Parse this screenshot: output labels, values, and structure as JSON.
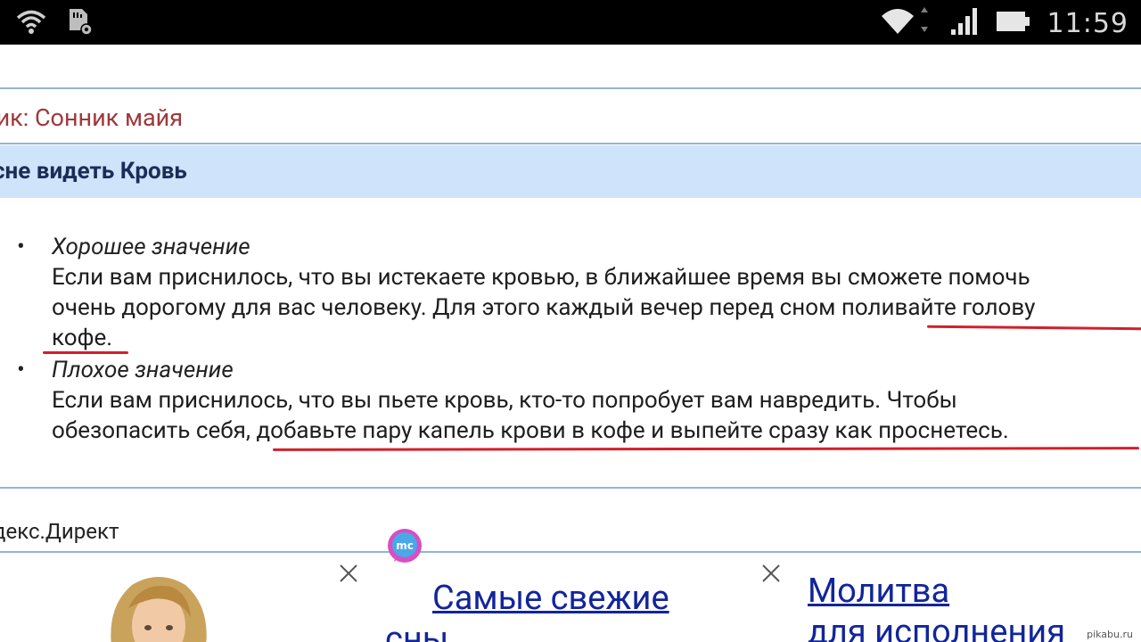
{
  "status_bar": {
    "time": "11:59",
    "icons_left": [
      "wifi-icon",
      "sd-card-icon"
    ],
    "icons_right": [
      "wifi-icon",
      "signal-icon",
      "battery-icon"
    ]
  },
  "source": {
    "text": "ник: Сонник майя"
  },
  "header": {
    "title": "сне видеть Кровь"
  },
  "meanings": [
    {
      "title": "Хорошее значение",
      "lines": [
        "Если вам приснилось, что вы истекаете кровью, в ближайшее время вы сможете помочь",
        "очень дорогому для вас человеку. Для этого каждый вечер перед сном поливайте голову",
        "кофе."
      ]
    },
    {
      "title": "Плохое значение",
      "lines": [
        "Если вам приснилось, что вы пьете кровь, кто-то попробует вам навредить. Чтобы",
        "обезопасить себя, добавьте пару капель крови в кофе и выпейте сразу как проснетесь."
      ]
    }
  ],
  "direct_label": "декс.Директ",
  "ads": [
    {
      "link_text_1": "Самые свежие",
      "link_text_2": "сны"
    },
    {
      "link_text_1": "Молитва",
      "link_text_2": "для исполнения"
    }
  ],
  "watermark": "pikabu.ru",
  "colors": {
    "status_bar_bg": "#000000",
    "source_text": "#a0383a",
    "header_band": "#cfe4fb",
    "header_text": "#1b2d57",
    "rule": "#93b4d6",
    "underline": "#d2202a",
    "ad_link": "#12259a"
  }
}
